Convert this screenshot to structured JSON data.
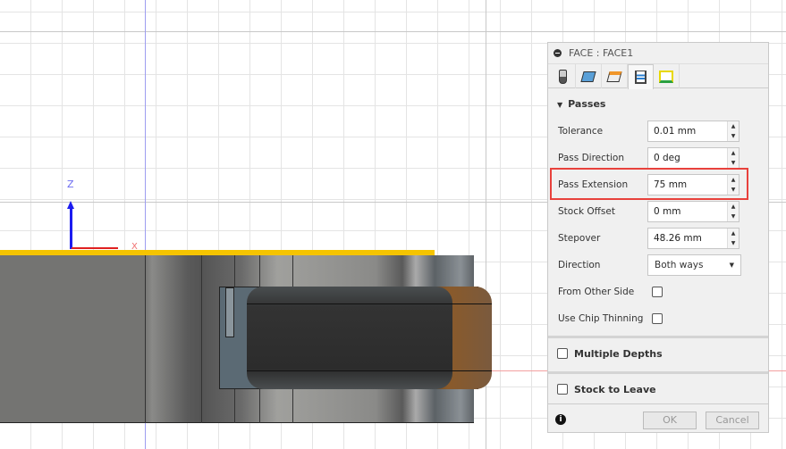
{
  "viewport": {
    "axis_z": "Z",
    "axis_x": "X"
  },
  "panel": {
    "title": "FACE : FACE1",
    "tabs": [
      {
        "icon": "tool-icon"
      },
      {
        "icon": "geometry-icon"
      },
      {
        "icon": "heights-icon"
      },
      {
        "icon": "passes-icon",
        "active": true
      },
      {
        "icon": "linking-icon"
      }
    ],
    "passes": {
      "header": "Passes",
      "tolerance": {
        "label": "Tolerance",
        "value": "0.01 mm"
      },
      "pass_direction": {
        "label": "Pass Direction",
        "value": "0 deg"
      },
      "pass_extension": {
        "label": "Pass Extension",
        "value": "75 mm"
      },
      "stock_offset": {
        "label": "Stock Offset",
        "value": "0 mm"
      },
      "stepover": {
        "label": "Stepover",
        "value": "48.26 mm"
      },
      "direction": {
        "label": "Direction",
        "value": "Both ways"
      },
      "from_other_side": {
        "label": "From Other Side",
        "checked": false
      },
      "use_chip_thinning": {
        "label": "Use Chip Thinning",
        "checked": false
      }
    },
    "multiple_depths": {
      "label": "Multiple Depths",
      "checked": false
    },
    "stock_to_leave": {
      "label": "Stock to Leave",
      "checked": false
    },
    "ok": "OK",
    "cancel": "Cancel",
    "highlight_color": "#e8413c"
  }
}
